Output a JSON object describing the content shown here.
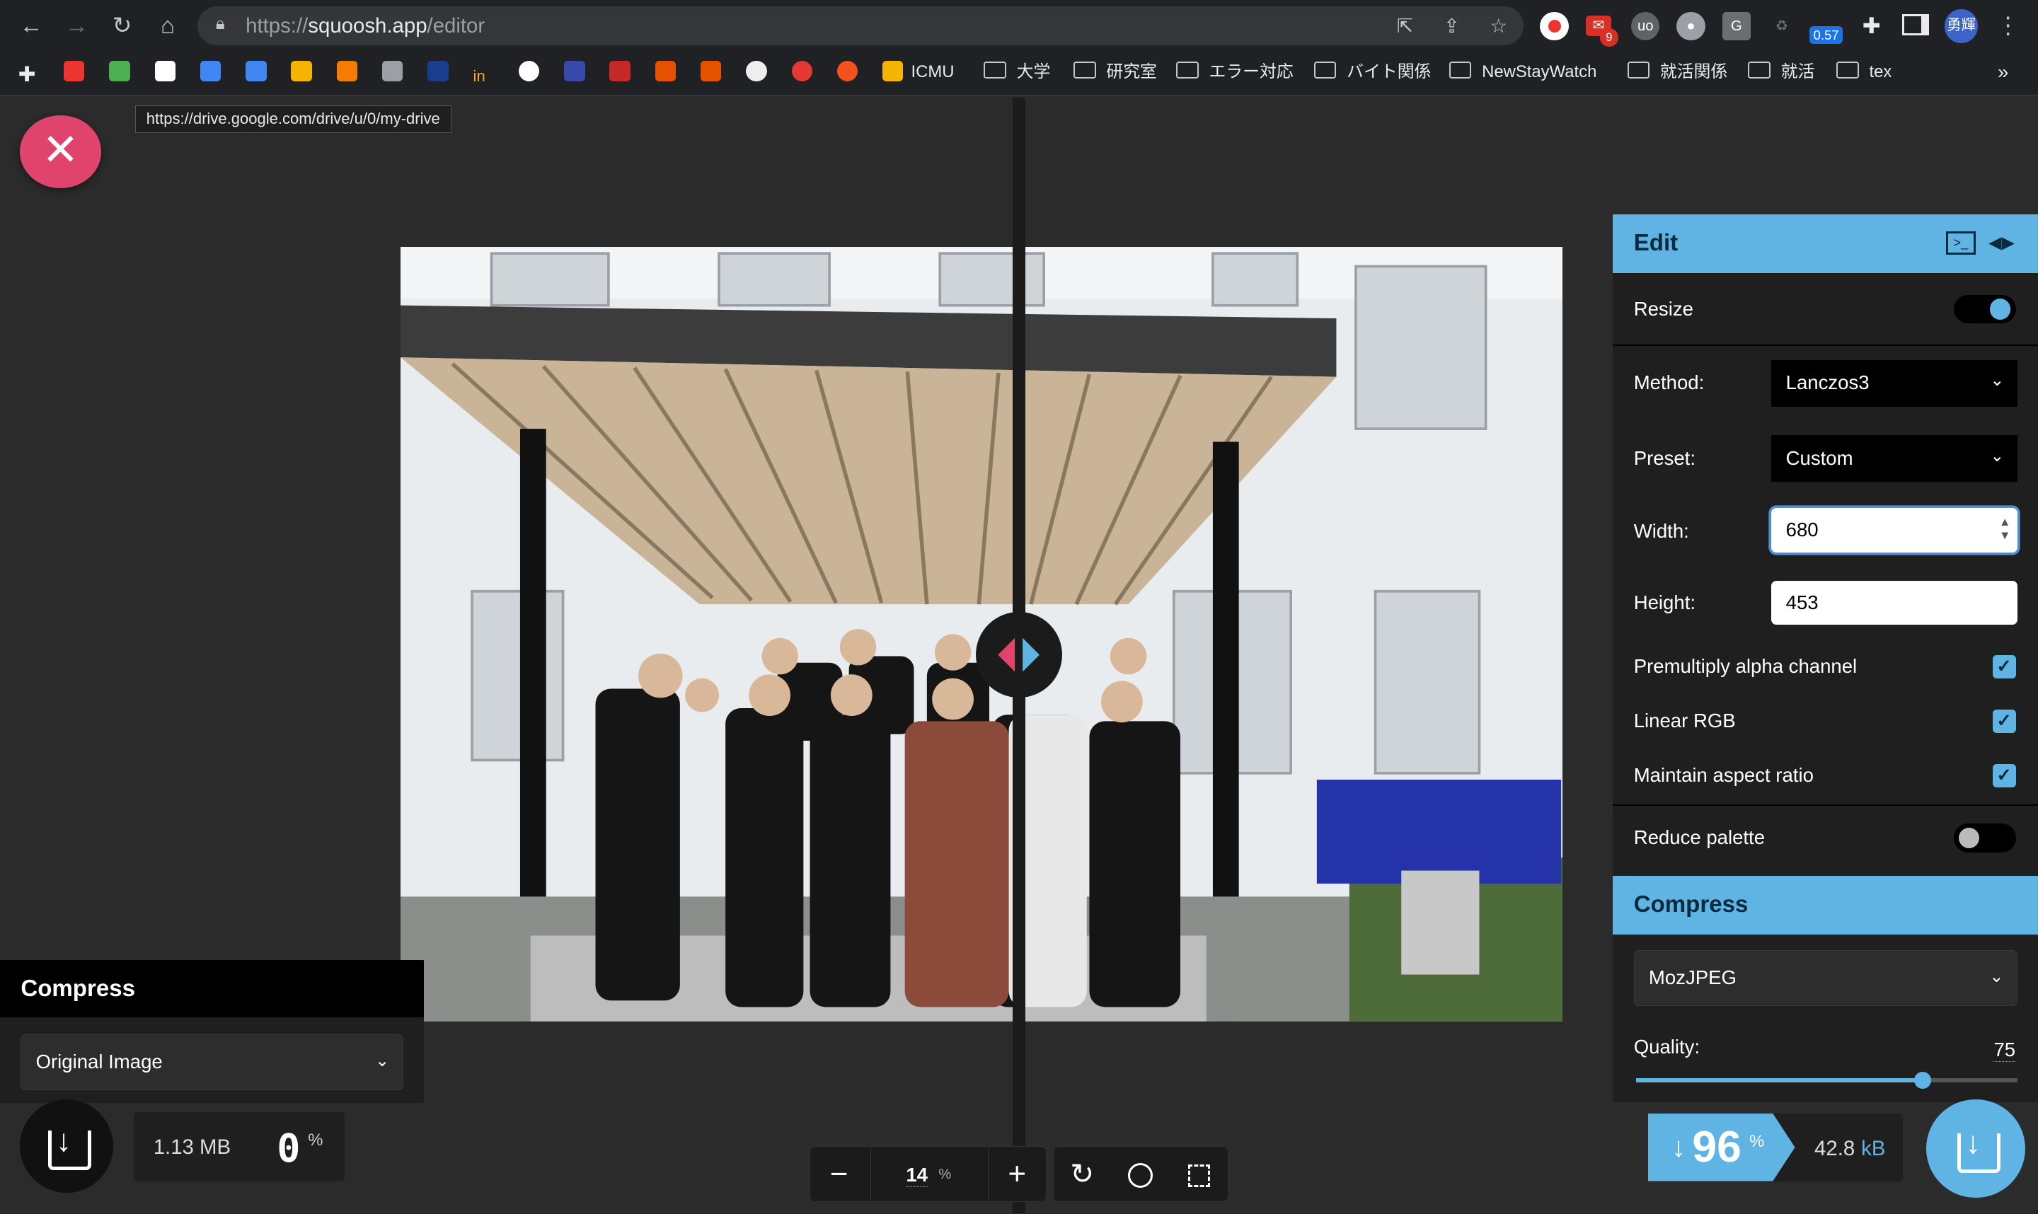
{
  "browser": {
    "url_prefix": "https://",
    "url_host": "squoosh.app",
    "url_path": "/editor",
    "profile_label": "勇輝",
    "badge_mail": "9",
    "badge_ext": "0.57",
    "bookmarks": [
      {
        "label": "ICMU",
        "type": "site"
      },
      {
        "label": "大学",
        "type": "folder"
      },
      {
        "label": "研究室",
        "type": "folder"
      },
      {
        "label": "エラー対応",
        "type": "folder"
      },
      {
        "label": "バイト関係",
        "type": "folder"
      },
      {
        "label": "NewStayWatch",
        "type": "folder"
      },
      {
        "label": "就活関係",
        "type": "folder"
      },
      {
        "label": "就活",
        "type": "folder"
      },
      {
        "label": "tex",
        "type": "folder"
      }
    ],
    "bookmarks_overflow": "»",
    "tooltip": "https://drive.google.com/drive/u/0/my-drive"
  },
  "left_panel": {
    "title": "Compress",
    "select_value": "Original Image",
    "file_size": "1.13 MB",
    "percent": "0",
    "percent_sign": "%"
  },
  "right_panel": {
    "edit_title": "Edit",
    "resize_label": "Resize",
    "resize_on": true,
    "method_label": "Method:",
    "method_value": "Lanczos3",
    "preset_label": "Preset:",
    "preset_value": "Custom",
    "width_label": "Width:",
    "width_value": "680",
    "height_label": "Height:",
    "height_value": "453",
    "premultiply_label": "Premultiply alpha channel",
    "linear_rgb_label": "Linear RGB",
    "aspect_label": "Maintain aspect ratio",
    "reduce_palette_label": "Reduce palette",
    "reduce_palette_on": false,
    "compress_title": "Compress",
    "codec_value": "MozJPEG",
    "quality_label": "Quality:",
    "quality_value": "75",
    "quality_fraction": 0.75,
    "savings_arrow": "↓",
    "savings_value": "96",
    "savings_sign": "%",
    "output_size": "42.8",
    "output_unit": "kB"
  },
  "zoom": {
    "minus": "−",
    "value": "14",
    "unit": "%",
    "plus": "+"
  },
  "colors": {
    "accent_blue": "#5fb4e4",
    "close_pink": "#e0446c",
    "panel_dark": "#1f1f1f"
  }
}
